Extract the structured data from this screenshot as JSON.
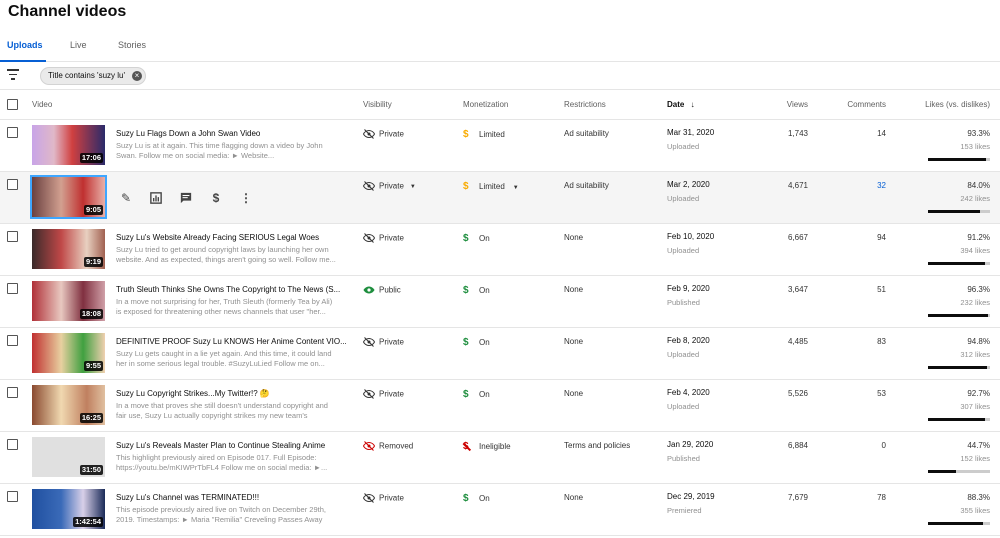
{
  "page_title": "Channel videos",
  "tabs": [
    {
      "label": "Uploads",
      "active": true
    },
    {
      "label": "Live",
      "active": false
    },
    {
      "label": "Stories",
      "active": false
    }
  ],
  "filter": {
    "icon": "filter-icon",
    "chip_label": "Title contains 'suzy lu'",
    "chip_close_icon": "close-circle-icon"
  },
  "columns": {
    "video": "Video",
    "visibility": "Visibility",
    "monetization": "Monetization",
    "restrictions": "Restrictions",
    "date": "Date",
    "date_sort_icon": "arrow-down-icon",
    "views": "Views",
    "comments": "Comments",
    "likes": "Likes (vs. dislikes)"
  },
  "colors": {
    "accent": "#065fd4",
    "monetized": "#1e8e3e",
    "limited": "#f9ab00",
    "removed": "#c00"
  },
  "row_actions": [
    "edit-icon",
    "analytics-icon",
    "comments-icon",
    "monetization-icon",
    "more-icon"
  ],
  "videos": [
    {
      "title": "Suzy Lu Flags Down a John Swan Video",
      "description": "Suzy Lu is at it again. This time flagging down a video by John Swan. Follow me on social media: ► Website...",
      "duration": "17:06",
      "visibility": "Private",
      "visibility_icon": "eye-off-icon",
      "monetization": "Limited",
      "monetization_icon": "dollar-icon",
      "restrictions": "Ad suitability",
      "date": "Mar 31, 2020",
      "date_status": "Uploaded",
      "views": "1,743",
      "comments": "14",
      "likes_pct": "93.3%",
      "likes_count": "153 likes",
      "likes_ratio": 0.933
    },
    {
      "title": "",
      "description": "",
      "duration": "9:05",
      "visibility": "Private",
      "visibility_icon": "eye-off-icon",
      "monetization": "Limited",
      "monetization_icon": "dollar-icon",
      "restrictions": "Ad suitability",
      "date": "Mar 2, 2020",
      "date_status": "Uploaded",
      "views": "4,671",
      "comments": "32",
      "likes_pct": "84.0%",
      "likes_count": "242 likes",
      "likes_ratio": 0.84
    },
    {
      "title": "Suzy Lu's Website Already Facing SERIOUS Legal Woes",
      "description": "Suzy Lu tried to get around copyright laws by launching her own website. And as expected, things aren't going so well. Follow me...",
      "duration": "9:19",
      "visibility": "Private",
      "visibility_icon": "eye-off-icon",
      "monetization": "On",
      "monetization_icon": "dollar-icon",
      "restrictions": "None",
      "date": "Feb 10, 2020",
      "date_status": "Uploaded",
      "views": "6,667",
      "comments": "94",
      "likes_pct": "91.2%",
      "likes_count": "394 likes",
      "likes_ratio": 0.912
    },
    {
      "title": "Truth Sleuth Thinks She Owns The Copyright to The News (S...",
      "description": "In a move not surprising for her, Truth Sleuth (formerly Tea by Ali) is exposed for threatening other news channels that user \"her...",
      "duration": "18:08",
      "visibility": "Public",
      "visibility_icon": "eye-icon",
      "monetization": "On",
      "monetization_icon": "dollar-icon",
      "restrictions": "None",
      "date": "Feb 9, 2020",
      "date_status": "Published",
      "views": "3,647",
      "comments": "51",
      "likes_pct": "96.3%",
      "likes_count": "232 likes",
      "likes_ratio": 0.963
    },
    {
      "title": "DEFINITIVE PROOF Suzy Lu KNOWS Her Anime Content VIO...",
      "description": "Suzy Lu gets caught in a lie yet again. And this time, it could land her in some serious legal trouble. #SuzyLuLied Follow me on...",
      "duration": "9:55",
      "visibility": "Private",
      "visibility_icon": "eye-off-icon",
      "monetization": "On",
      "monetization_icon": "dollar-icon",
      "restrictions": "None",
      "date": "Feb 8, 2020",
      "date_status": "Uploaded",
      "views": "4,485",
      "comments": "83",
      "likes_pct": "94.8%",
      "likes_count": "312 likes",
      "likes_ratio": 0.948
    },
    {
      "title": "Suzy Lu Copyright Strikes...My Twitter!? 🤔",
      "description": "In a move that proves she still doesn't understand copyright and fair use, Suzy Lu actually copyright strikes my new team's Twitter...",
      "duration": "16:25",
      "visibility": "Private",
      "visibility_icon": "eye-off-icon",
      "monetization": "On",
      "monetization_icon": "dollar-icon",
      "restrictions": "None",
      "date": "Feb 4, 2020",
      "date_status": "Uploaded",
      "views": "5,526",
      "comments": "53",
      "likes_pct": "92.7%",
      "likes_count": "307 likes",
      "likes_ratio": 0.927
    },
    {
      "title": "Suzy Lu's Reveals Master Plan to Continue Stealing Anime",
      "description": "This highlight previously aired on Episode 017. Full Episode: https://youtu.be/mKIWPrTbFL4 Follow me on social media: ►...",
      "duration": "31:50",
      "visibility": "Removed",
      "visibility_icon": "eye-off-icon",
      "monetization": "Ineligible",
      "monetization_icon": "dollar-off-icon",
      "restrictions": "Terms and policies",
      "date": "Jan 29, 2020",
      "date_status": "Published",
      "views": "6,884",
      "comments": "0",
      "likes_pct": "44.7%",
      "likes_count": "152 likes",
      "likes_ratio": 0.447
    },
    {
      "title": "Suzy Lu's Channel was TERMINATED!!!",
      "description": "This episode previously aired live on Twitch on December 29th, 2019. Timestamps: ► Maria \"Remilia\" Creveling Passes Away at...",
      "duration": "1:42:54",
      "visibility": "Private",
      "visibility_icon": "eye-off-icon",
      "monetization": "On",
      "monetization_icon": "dollar-icon",
      "restrictions": "None",
      "date": "Dec 29, 2019",
      "date_status": "Premiered",
      "views": "7,679",
      "comments": "78",
      "likes_pct": "88.3%",
      "likes_count": "355 likes",
      "likes_ratio": 0.883
    }
  ]
}
